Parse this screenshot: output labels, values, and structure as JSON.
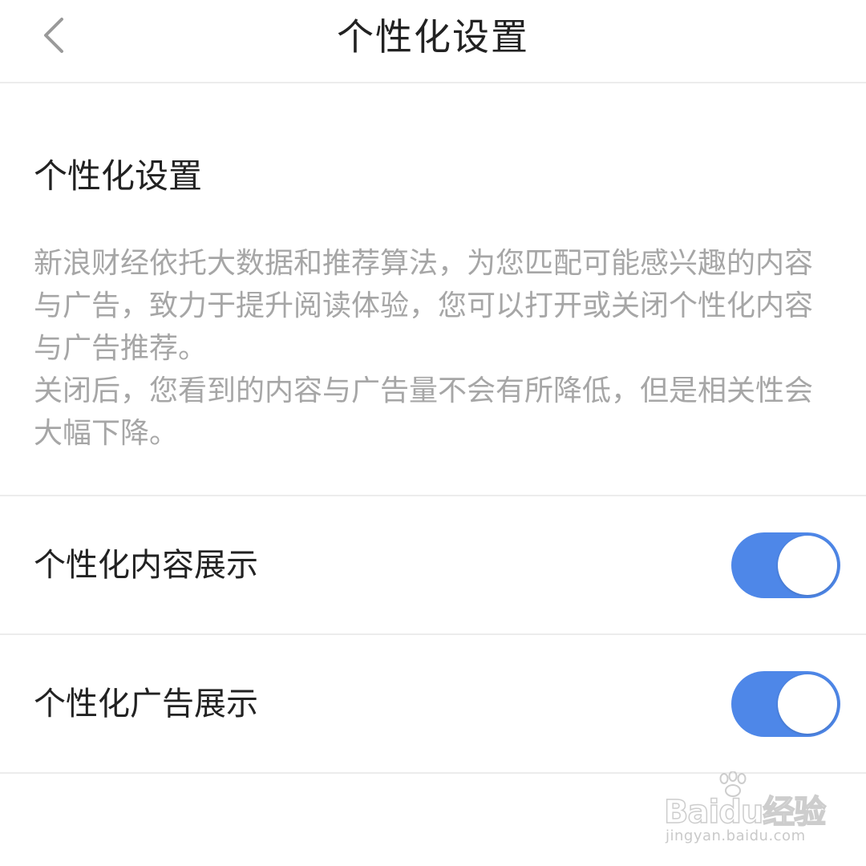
{
  "header": {
    "title": "个性化设置",
    "back_icon": "chevron-left-icon"
  },
  "section": {
    "title": "个性化设置",
    "description": [
      "新浪财经依托大数据和推荐算法，为您匹配可能感兴趣的内容与广告，致力于提升阅读体验，您可以打开或关闭个性化内容与广告推荐。",
      "关闭后，您看到的内容与广告量不会有所降低，但是相关性会大幅下降。"
    ]
  },
  "settings": [
    {
      "label": "个性化内容展示",
      "enabled": true
    },
    {
      "label": "个性化广告展示",
      "enabled": true
    }
  ],
  "colors": {
    "toggle_on": "#4e87e8",
    "title_text": "#222222",
    "description_text": "#a6a6a6",
    "divider": "#ececec"
  },
  "watermark": {
    "logo": "Baidu经验",
    "url": "jingyan.baidu.com"
  }
}
